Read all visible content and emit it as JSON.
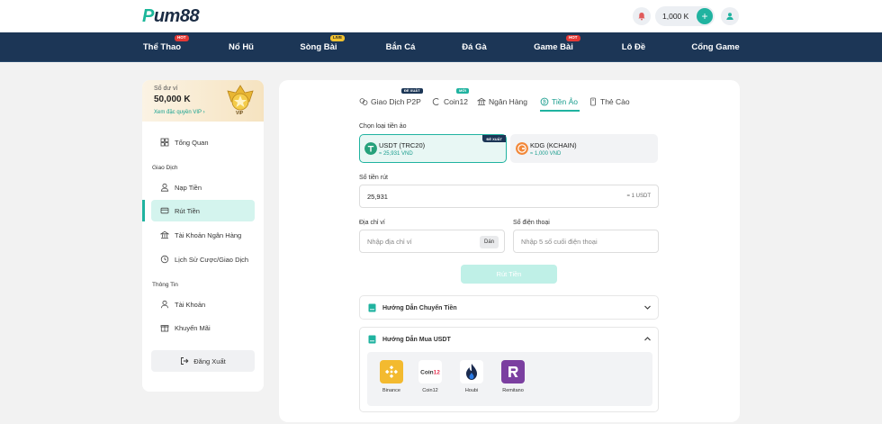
{
  "header": {
    "logo_prefix": "P",
    "logo_text": "um88",
    "balance": "1,000 K",
    "plus": "+"
  },
  "nav": [
    {
      "label": "Thể Thao",
      "badge": "HOT"
    },
    {
      "label": "Nổ Hũ",
      "badge": ""
    },
    {
      "label": "Sòng Bài",
      "badge": "LIVE"
    },
    {
      "label": "Bắn Cá",
      "badge": ""
    },
    {
      "label": "Đá Gà",
      "badge": ""
    },
    {
      "label": "Game Bài",
      "badge": "HOT"
    },
    {
      "label": "Lô Đề",
      "badge": ""
    },
    {
      "label": "Cổng Game",
      "badge": ""
    }
  ],
  "sidebar": {
    "balance_label": "Số dư ví",
    "balance_amount": "50,000 K",
    "vip_link": "Xem đặc quyền VIP  ›",
    "vip_badge": "VIP",
    "overview": "Tổng Quan",
    "section_transactions": "Giao Dịch",
    "deposit": "Nạp Tiền",
    "withdraw": "Rút Tiền",
    "bank_account": "Tài Khoản Ngân Hàng",
    "history": "Lịch Sử Cược/Giao Dịch",
    "section_info": "Thông Tin",
    "account": "Tài Khoản",
    "promotions": "Khuyến Mãi",
    "logout": "Đăng Xuất"
  },
  "tabs": {
    "p2p": "Giao Dịch P2P",
    "p2p_badge": "ĐỀ XUẤT",
    "coin12": "Coin12",
    "coin12_badge": "MỚI",
    "bank": "Ngân Hàng",
    "crypto": "Tiền Ảo",
    "card": "Thẻ Cào"
  },
  "form": {
    "choose_crypto_label": "Chọn loại tiền ảo",
    "usdt_name": "USDT (TRC20)",
    "usdt_rate": "≈ 25,931 VND",
    "recommended_flag": "ĐỀ XUẤT",
    "kdg_name": "KDG (KCHAIN)",
    "kdg_rate": "≈ 1,000 VND",
    "amount_label": "Số tiền rút",
    "amount_value": "25,931",
    "amount_suffix": "= 1 USDT",
    "wallet_label": "Địa chỉ ví",
    "wallet_placeholder": "Nhập địa chỉ ví",
    "paste_label": "Dán",
    "phone_label": "Số điện thoại",
    "phone_placeholder": "Nhập 5 số cuối điện thoại",
    "submit_label": "Rút Tiền"
  },
  "guides": {
    "transfer_title": "Hướng Dẫn Chuyển Tiền",
    "buy_title": "Hướng Dẫn Mua USDT",
    "apps": [
      {
        "name": "Binance",
        "color": "#f3ba2f"
      },
      {
        "name": "Coin12",
        "color": "#ffffff"
      },
      {
        "name": "Houbi",
        "color": "#1b2b4f"
      },
      {
        "name": "Remitano",
        "color": "#7b3fa0"
      }
    ]
  },
  "colors": {
    "accent": "#20b3a0",
    "navbar": "#1c3656",
    "hot_badge": "#e53935",
    "live_badge": "#f4c430"
  }
}
